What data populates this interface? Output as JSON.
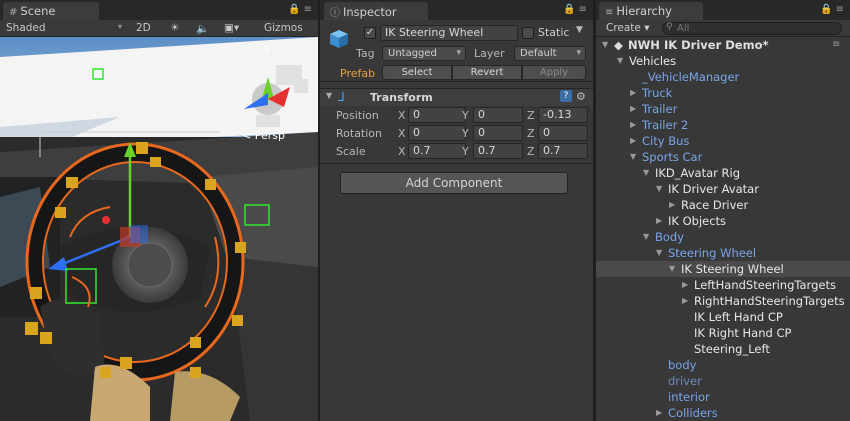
{
  "scene": {
    "tab_label": "Scene",
    "shading_mode": "Shaded",
    "mode_2d": "2D",
    "gizmos_label": "Gizmos",
    "persp_label": "< Persp",
    "gizmo_axis_y": "y"
  },
  "inspector": {
    "tab_label": "Inspector",
    "object_name": "IK Steering Wheel",
    "active_checked": "✓",
    "static_label": "Static",
    "tag_label": "Tag",
    "tag_value": "Untagged",
    "layer_label": "Layer",
    "layer_value": "Default",
    "prefab_label": "Prefab",
    "prefab_select": "Select",
    "prefab_revert": "Revert",
    "prefab_apply": "Apply",
    "transform_label": "Transform",
    "position_label": "Position",
    "rotation_label": "Rotation",
    "scale_label": "Scale",
    "axis_x": "X",
    "axis_y": "Y",
    "axis_z": "Z",
    "position": {
      "x": "0",
      "y": "0",
      "z": "-0.13"
    },
    "rotation": {
      "x": "0",
      "y": "0",
      "z": "0"
    },
    "scale": {
      "x": "0.7",
      "y": "0.7",
      "z": "0.7"
    },
    "add_component_label": "Add Component"
  },
  "hierarchy": {
    "tab_label": "Hierarchy",
    "create_label": "Create",
    "search_placeholder": "All",
    "root_label": "NWH IK Driver Demo*",
    "items": [
      {
        "label": "Vehicles",
        "depth": 1,
        "arrow": "open",
        "color": "white"
      },
      {
        "label": "_VehicleManager",
        "depth": 2,
        "arrow": "none",
        "color": "blue"
      },
      {
        "label": "Truck",
        "depth": 2,
        "arrow": "closed",
        "color": "blue"
      },
      {
        "label": "Trailer",
        "depth": 2,
        "arrow": "closed",
        "color": "blue"
      },
      {
        "label": "Trailer 2",
        "depth": 2,
        "arrow": "closed",
        "color": "blue"
      },
      {
        "label": "City Bus",
        "depth": 2,
        "arrow": "closed",
        "color": "blue"
      },
      {
        "label": "Sports Car",
        "depth": 2,
        "arrow": "open",
        "color": "blue"
      },
      {
        "label": "IKD_Avatar Rig",
        "depth": 3,
        "arrow": "open",
        "color": "white"
      },
      {
        "label": "IK Driver Avatar",
        "depth": 4,
        "arrow": "open",
        "color": "white"
      },
      {
        "label": "Race Driver",
        "depth": 5,
        "arrow": "closed",
        "color": "white"
      },
      {
        "label": "IK Objects",
        "depth": 4,
        "arrow": "closed",
        "color": "white"
      },
      {
        "label": "Body",
        "depth": 3,
        "arrow": "open",
        "color": "blue"
      },
      {
        "label": "Steering Wheel",
        "depth": 4,
        "arrow": "open",
        "color": "blue"
      },
      {
        "label": "IK Steering Wheel",
        "depth": 5,
        "arrow": "open",
        "color": "white",
        "selected": true
      },
      {
        "label": "LeftHandSteeringTargets",
        "depth": 6,
        "arrow": "closed",
        "color": "white"
      },
      {
        "label": "RightHandSteeringTargets",
        "depth": 6,
        "arrow": "closed",
        "color": "white"
      },
      {
        "label": "IK Left Hand CP",
        "depth": 6,
        "arrow": "none",
        "color": "white"
      },
      {
        "label": "IK Right Hand CP",
        "depth": 6,
        "arrow": "none",
        "color": "white"
      },
      {
        "label": "Steering_Left",
        "depth": 6,
        "arrow": "none",
        "color": "white"
      },
      {
        "label": "body",
        "depth": 4,
        "arrow": "none",
        "color": "blue"
      },
      {
        "label": "driver",
        "depth": 4,
        "arrow": "none",
        "color": "dimblue"
      },
      {
        "label": "interior",
        "depth": 4,
        "arrow": "none",
        "color": "blue"
      },
      {
        "label": "Colliders",
        "depth": 4,
        "arrow": "closed",
        "color": "blue"
      }
    ]
  },
  "colors": {
    "accent_orange": "#e8681e",
    "selection_blue": "#7aa5e8",
    "prefab_orange": "#e8a33a"
  }
}
